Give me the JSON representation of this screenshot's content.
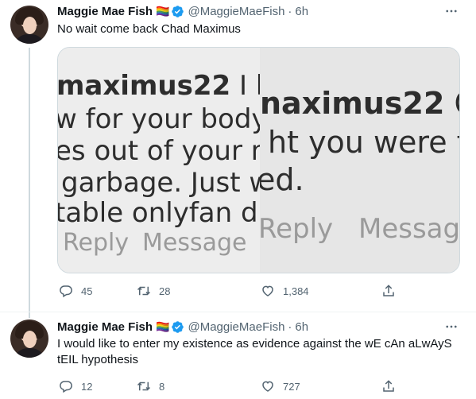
{
  "tweets": [
    {
      "name": "Maggie Mae Fish",
      "flag": "🏳️‍🌈",
      "handle": "@MaggieMaeFish",
      "separator": "·",
      "time": "6h",
      "text": "No wait come back Chad Maximus",
      "media": {
        "left": {
          "l1a": "maximus22",
          "l1b": " I litera",
          "l2": "w for your body, ar",
          "l3": "es out of your mout",
          "l4": "garbage. Just wait",
          "l5": "table onlyfan drop",
          "reply": "Reply",
          "message": "Message"
        },
        "right": {
          "l1a": "naximus22",
          "l1b": " Oh",
          "l2": "ht you were tr",
          "l3": "ed.",
          "reply": "Reply",
          "message": "Message"
        }
      },
      "replies": "45",
      "retweets": "28",
      "likes": "1,384"
    },
    {
      "name": "Maggie Mae Fish",
      "flag": "🏳️‍🌈",
      "handle": "@MaggieMaeFish",
      "separator": "·",
      "time": "6h",
      "text": "I would like to enter my existence as evidence against the wE cAn aLwAyS tEIL hypothesis",
      "replies": "12",
      "retweets": "8",
      "likes": "727"
    }
  ],
  "icons": {
    "more": "more-horizontal-icon",
    "verified": "verified-badge-icon",
    "reply": "reply-bubble-icon",
    "retweet": "retweet-icon",
    "like": "heart-icon",
    "share": "share-icon"
  },
  "colors": {
    "verified": "#1d9bf0",
    "secondary_text": "#536471",
    "thread_line": "#cfd9de"
  }
}
